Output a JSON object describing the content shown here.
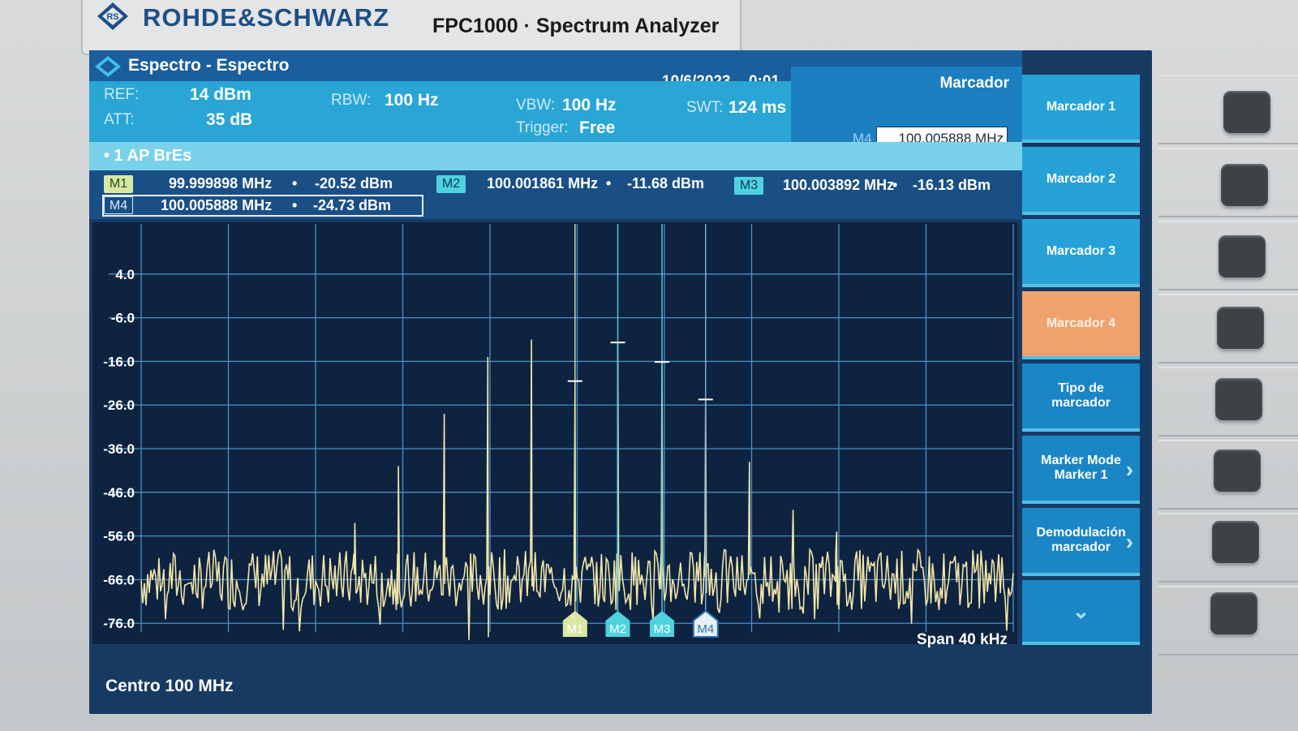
{
  "brand": {
    "name": "ROHDE&SCHWARZ",
    "model": "FPC1000 · Spectrum Analyzer"
  },
  "titlebar": {
    "title": "Espectro - Espectro",
    "date": "10/6/2023",
    "time": "0:01"
  },
  "params": {
    "ref_label": "REF:",
    "ref_value": "14 dBm",
    "att_label": "ATT:",
    "att_value": "35 dB",
    "rbw_label": "RBW:",
    "rbw_value": "100 Hz",
    "vbw_label": "VBW:",
    "vbw_value": "100 Hz",
    "trigger_label": "Trigger:",
    "trigger_value": "Free",
    "swt_label": "SWT:",
    "swt_value": "124 ms"
  },
  "marker_panel": {
    "title": "Marcador",
    "field_label": "M4",
    "field_value": "100.005888 MHz"
  },
  "trace": {
    "label": "• 1 AP BrEs"
  },
  "markers": [
    {
      "tag": "M1",
      "freq": "99.999898 MHz",
      "level": "-20.52 dBm",
      "color": "#d9e8a4"
    },
    {
      "tag": "M2",
      "freq": "100.001861 MHz",
      "level": "-11.68 dBm",
      "color": "#4fd2e0"
    },
    {
      "tag": "M3",
      "freq": "100.003892 MHz",
      "level": "-16.13 dBm",
      "color": "#4fd2e0"
    },
    {
      "tag": "M4",
      "freq": "100.005888 MHz",
      "level": "-24.73 dBm",
      "color": "#2a6fb0"
    }
  ],
  "plot": {
    "y_ticks": [
      "4.0",
      "-6.0",
      "-16.0",
      "-26.0",
      "-36.0",
      "-46.0",
      "-56.0",
      "-66.0",
      "-76.0"
    ],
    "span": "Span 40 kHz",
    "center": "Centro 100 MHz"
  },
  "chart_data": {
    "type": "line",
    "title": "",
    "xlabel": "",
    "ylabel": "",
    "y_unit": "dBm",
    "ylim": [
      -78,
      14
    ],
    "center_MHz": 100,
    "span_kHz": 40,
    "noise_floor_dBm": -62,
    "peaks": [
      {
        "offset_kHz": -10.2,
        "level": -53
      },
      {
        "offset_kHz": -8.2,
        "level": -40
      },
      {
        "offset_kHz": -6.1,
        "level": -28
      },
      {
        "offset_kHz": -4.1,
        "level": -15
      },
      {
        "offset_kHz": -2.1,
        "level": -11
      },
      {
        "offset_kHz": -0.1,
        "level": -20.52
      },
      {
        "offset_kHz": 1.86,
        "level": -11.68
      },
      {
        "offset_kHz": 3.89,
        "level": -16.13
      },
      {
        "offset_kHz": 5.89,
        "level": -24.73
      },
      {
        "offset_kHz": 7.9,
        "level": -39
      },
      {
        "offset_kHz": 9.9,
        "level": -50
      },
      {
        "offset_kHz": 11.9,
        "level": -55
      }
    ],
    "grid": true
  },
  "softkeys": [
    {
      "label": "Marcador 1",
      "arrow": ""
    },
    {
      "label": "Marcador 2",
      "arrow": ""
    },
    {
      "label": "Marcador 3",
      "arrow": ""
    },
    {
      "label": "Marcador 4",
      "arrow": ""
    },
    {
      "label": "Tipo de marcador",
      "arrow": ""
    },
    {
      "label": "Marker Mode Marker 1",
      "arrow": "›"
    },
    {
      "label": "Demodulación marcador",
      "arrow": "›"
    },
    {
      "label": "⌄",
      "arrow": ""
    }
  ]
}
